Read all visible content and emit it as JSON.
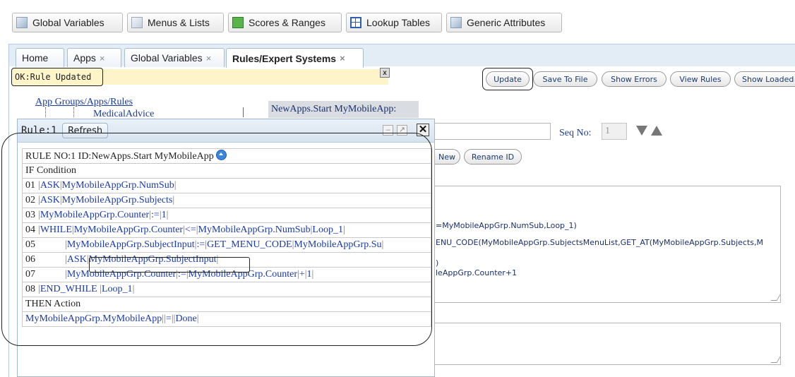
{
  "toolbar": {
    "buttons": [
      {
        "label": "Global Variables",
        "icon": "document-icon"
      },
      {
        "label": "Menus & Lists",
        "icon": "menu-icon"
      },
      {
        "label": "Scores & Ranges",
        "icon": "scores-icon"
      },
      {
        "label": "Lookup Tables",
        "icon": "table-icon"
      },
      {
        "label": "Generic Attributes",
        "icon": "document-icon"
      }
    ]
  },
  "tabs": [
    {
      "label": "Home",
      "closable": false
    },
    {
      "label": "Apps",
      "closable": true
    },
    {
      "label": "Global Variables",
      "closable": true
    },
    {
      "label": "Rules/Expert Systems",
      "closable": true,
      "active": true
    }
  ],
  "tab_close_glyph": "×",
  "status": {
    "message": "OK:Rule Updated",
    "close_glyph": "x"
  },
  "actions": [
    "Update",
    "Save To File",
    "Show Errors",
    "View Rules",
    "Show Loaded"
  ],
  "tree": {
    "root_link": "App Groups/Apps/Rules",
    "child": "MedicalAdvice"
  },
  "editor": {
    "rule_title": "NewApps.Start MyMobileApp:",
    "seq_label": "Seq No:",
    "seq_value": "1",
    "new_button": "New",
    "rename_button": "Rename ID",
    "condition_lines": [
      "=MyMobileAppGrp.NumSub,Loop_1)",
      "ENU_CODE(MyMobileAppGrp.SubjectsMenuList,GET_AT(MyMobileAppGrp.Subjects,M",
      ")",
      "leAppGrp.Counter+1"
    ]
  },
  "rule_window": {
    "title": "Rule:1",
    "refresh_label": "Refresh",
    "header": "RULE NO:1 ID:NewApps.Start MyMobileApp",
    "if_label": "IF Condition",
    "then_label": "THEN Action",
    "condition_rows": [
      {
        "num": "01",
        "parts": [
          [
            "ASK",
            "blue"
          ],
          [
            "MyMobileAppGrp.NumSub",
            "blue"
          ]
        ]
      },
      {
        "num": "02",
        "parts": [
          [
            "ASK",
            "blue"
          ],
          [
            "MyMobileAppGrp.Subjects",
            "blue"
          ]
        ]
      },
      {
        "num": "03",
        "parts": [
          [
            "MyMobileAppGrp.Counter",
            "blue"
          ],
          [
            ":=",
            "blue"
          ],
          [
            "1",
            "blue"
          ]
        ]
      },
      {
        "num": "04",
        "parts": [
          [
            "WHILE",
            "blue"
          ],
          [
            "MyMobileAppGrp.Counter",
            "blue"
          ],
          [
            "<=",
            "blue"
          ],
          [
            "MyMobileAppGrp.NumSub",
            "blue"
          ],
          [
            "Loop_1",
            "blue"
          ]
        ]
      },
      {
        "num": "05",
        "indent": true,
        "parts": [
          [
            "MyMobileAppGrp.SubjectInput",
            "blue"
          ],
          [
            ":=",
            "blue"
          ],
          [
            "GET_MENU_CODE",
            "blue"
          ],
          [
            "MyMobileAppGrp.Su",
            "blue"
          ]
        ]
      },
      {
        "num": "06",
        "indent": true,
        "parts": [
          [
            "ASK",
            "blue"
          ],
          [
            "MyMobileAppGrp.SubjectInput",
            "blue"
          ]
        ]
      },
      {
        "num": "07",
        "indent": true,
        "parts": [
          [
            "MyMobileAppGrp.Counter",
            "blue"
          ],
          [
            ":=",
            "blue"
          ],
          [
            "MyMobileAppGrp.Counter",
            "blue"
          ],
          [
            "+",
            "blue"
          ],
          [
            "1",
            "blue"
          ]
        ]
      },
      {
        "num": "08",
        "parts": [
          [
            "END_WHILE ",
            "blue"
          ],
          [
            "Loop_1",
            "blue"
          ]
        ]
      }
    ],
    "action_row": {
      "parts": [
        [
          "MyMobileAppGrp.MyMobileApp",
          "blue"
        ],
        [
          "=",
          "blue"
        ],
        [
          "Done",
          "blue"
        ]
      ]
    }
  }
}
